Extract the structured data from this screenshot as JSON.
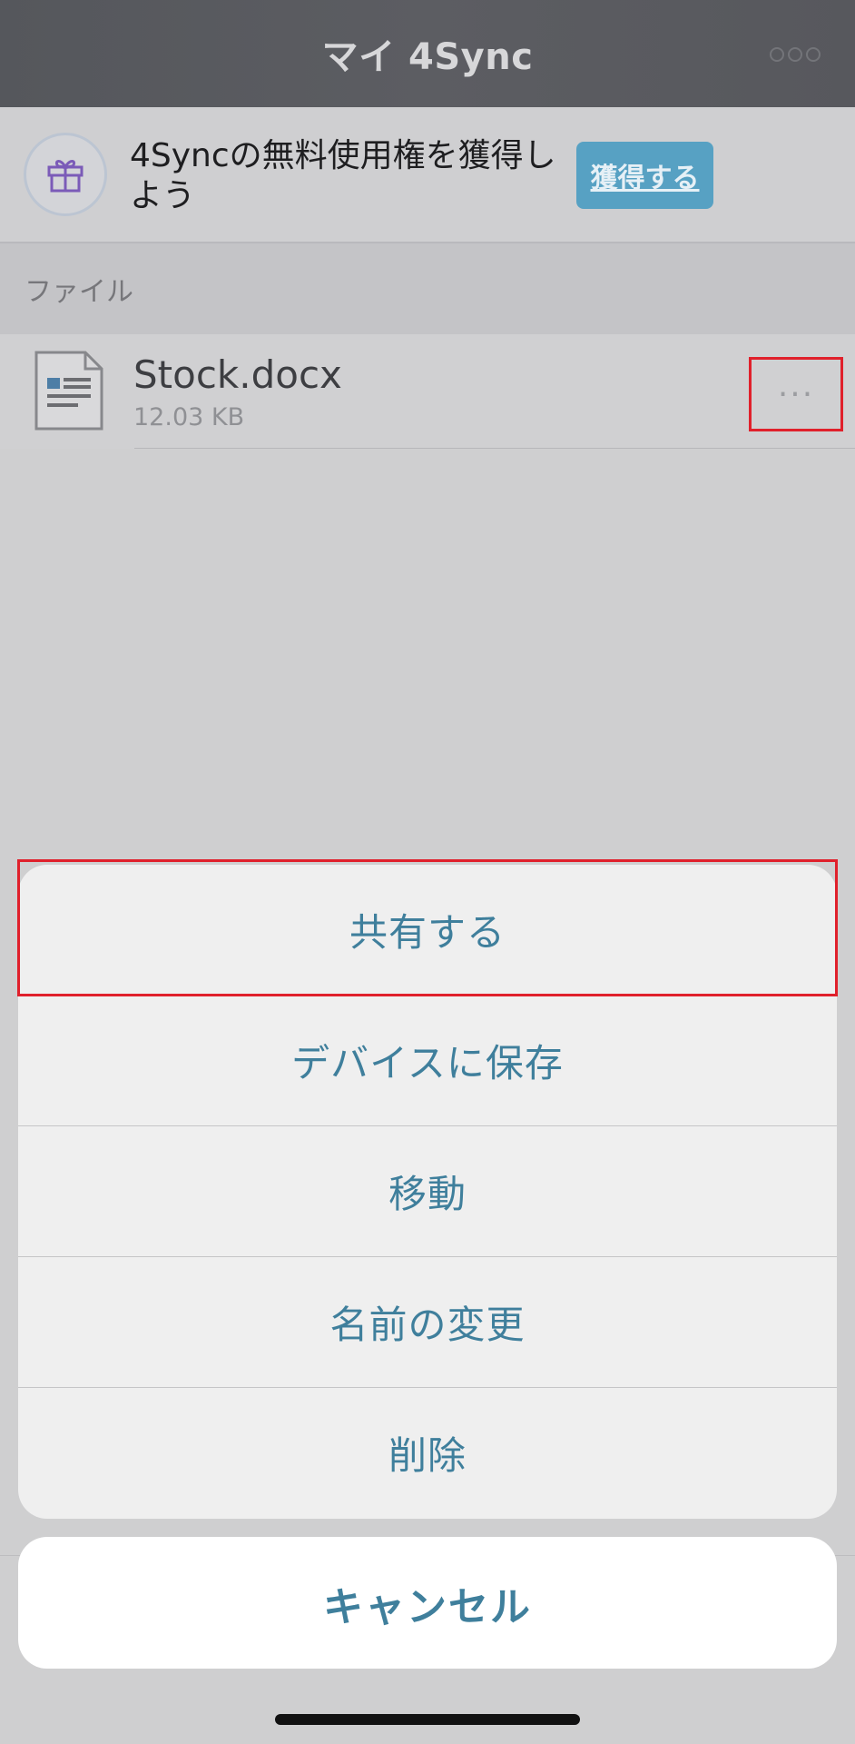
{
  "navbar": {
    "title": "マイ 4Sync",
    "right_icon": "sync-icon"
  },
  "promo": {
    "icon": "gift-icon",
    "text": "4Syncの無料使用権を獲得しよう",
    "button_label": "獲得する"
  },
  "section": {
    "title": "ファイル"
  },
  "file": {
    "icon": "document-icon",
    "name": "Stock.docx",
    "size": "12.03 KB",
    "more_label": "···"
  },
  "action_sheet": {
    "items": [
      {
        "label": "共有する"
      },
      {
        "label": "デバイスに保存"
      },
      {
        "label": "移動"
      },
      {
        "label": "名前の変更"
      },
      {
        "label": "削除"
      }
    ],
    "cancel_label": "キャンセル"
  },
  "colors": {
    "accent": "#3f7f9c",
    "button_blue": "#57a1c3",
    "highlight_red": "#e0202b"
  }
}
